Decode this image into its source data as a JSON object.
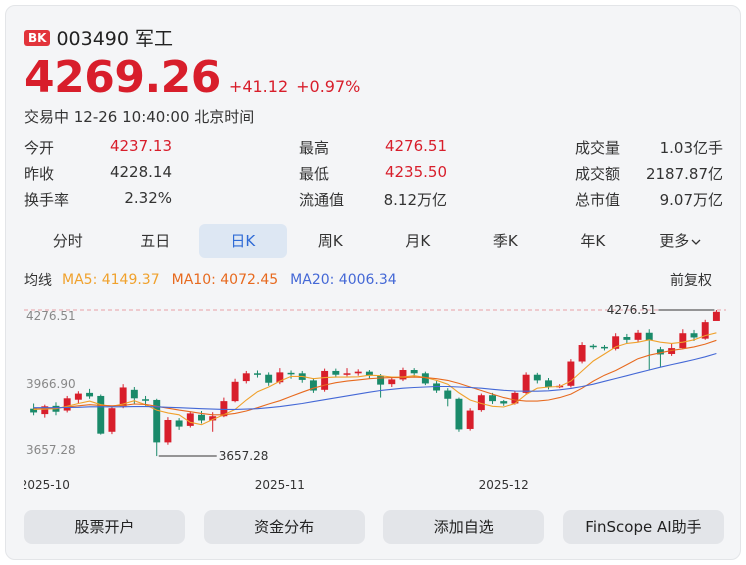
{
  "header": {
    "badge": "BK",
    "code_name": "003490 军工",
    "price": "4269.26",
    "change_abs": "+41.12",
    "change_pct": "+0.97%",
    "status": "交易中 12-26 10:40:00 北京时间"
  },
  "stats": {
    "open": {
      "label": "今开",
      "value": "4237.13"
    },
    "high": {
      "label": "最高",
      "value": "4276.51"
    },
    "volume": {
      "label": "成交量",
      "value": "1.03亿手"
    },
    "prev_close": {
      "label": "昨收",
      "value": "4228.14"
    },
    "low": {
      "label": "最低",
      "value": "4235.50"
    },
    "turnover": {
      "label": "成交额",
      "value": "2187.87亿"
    },
    "turnover_rate": {
      "label": "换手率",
      "value": "2.32%"
    },
    "float_cap": {
      "label": "流通值",
      "value": "8.12万亿"
    },
    "total_cap": {
      "label": "总市值",
      "value": "9.07万亿"
    }
  },
  "tabs": [
    {
      "label": "分时"
    },
    {
      "label": "五日"
    },
    {
      "label": "日K"
    },
    {
      "label": "周K"
    },
    {
      "label": "月K"
    },
    {
      "label": "季K"
    },
    {
      "label": "年K"
    },
    {
      "label": "更多"
    }
  ],
  "active_tab": 2,
  "ma": {
    "label": "均线",
    "ma5": "MA5: 4149.37",
    "ma10": "MA10: 4072.45",
    "ma20": "MA20: 4006.34",
    "adjust": "前复权"
  },
  "colors": {
    "up": "#d81e2b",
    "down": "#1a8a6a",
    "ma5": "#f0a12c",
    "ma10": "#e76a1f",
    "ma20": "#4468d6",
    "accent": "#2f6bd6"
  },
  "chart_data": {
    "type": "candlestick",
    "y_ticks": [
      "4276.51",
      "3966.90",
      "3657.28"
    ],
    "ylim": [
      3657.28,
      4276.51
    ],
    "x_ticks": [
      {
        "label": "2025-10",
        "index": 1
      },
      {
        "label": "2025-11",
        "index": 22
      },
      {
        "label": "2025-12",
        "index": 42
      }
    ],
    "max_label": "4276.51",
    "min_label": "3657.28",
    "candles": [
      [
        3858,
        3842,
        3880,
        3830
      ],
      [
        3835,
        3868,
        3875,
        3820
      ],
      [
        3870,
        3845,
        3885,
        3830
      ],
      [
        3850,
        3902,
        3912,
        3842
      ],
      [
        3896,
        3922,
        3932,
        3882
      ],
      [
        3925,
        3910,
        3942,
        3900
      ],
      [
        3912,
        3752,
        3918,
        3748
      ],
      [
        3760,
        3860,
        3870,
        3750
      ],
      [
        3868,
        3948,
        3962,
        3860
      ],
      [
        3938,
        3902,
        3950,
        3880
      ],
      [
        3898,
        3895,
        3912,
        3870
      ],
      [
        3895,
        3715,
        3900,
        3657
      ],
      [
        3715,
        3810,
        3822,
        3705
      ],
      [
        3808,
        3782,
        3818,
        3768
      ],
      [
        3785,
        3838,
        3847,
        3778
      ],
      [
        3832,
        3808,
        3848,
        3795
      ],
      [
        3808,
        3826,
        3843,
        3760
      ],
      [
        3826,
        3890,
        3905,
        3822
      ],
      [
        3890,
        3972,
        3985,
        3885
      ],
      [
        3975,
        4008,
        4018,
        3965
      ],
      [
        4008,
        4002,
        4020,
        3990
      ],
      [
        4002,
        3968,
        4012,
        3955
      ],
      [
        3970,
        4012,
        4030,
        3962
      ],
      [
        4010,
        4005,
        4020,
        3985
      ],
      [
        4008,
        3980,
        4018,
        3968
      ],
      [
        3978,
        3935,
        3988,
        3925
      ],
      [
        3938,
        4018,
        4028,
        3930
      ],
      [
        4018,
        4002,
        4028,
        3990
      ],
      [
        4002,
        4008,
        4030,
        3995
      ],
      [
        4008,
        4015,
        4025,
        3998
      ],
      [
        4015,
        3998,
        4022,
        3985
      ],
      [
        3998,
        3960,
        4005,
        3905
      ],
      [
        3962,
        3982,
        3990,
        3950
      ],
      [
        3982,
        4022,
        4032,
        3975
      ],
      [
        4022,
        4008,
        4030,
        3990
      ],
      [
        4008,
        3965,
        4015,
        3958
      ],
      [
        3965,
        3935,
        3975,
        3925
      ],
      [
        3935,
        3900,
        3945,
        3868
      ],
      [
        3900,
        3770,
        3905,
        3760
      ],
      [
        3772,
        3850,
        3860,
        3765
      ],
      [
        3852,
        3915,
        3922,
        3845
      ],
      [
        3915,
        3890,
        3925,
        3878
      ],
      [
        3890,
        3880,
        3895,
        3870
      ],
      [
        3880,
        3925,
        3932,
        3875
      ],
      [
        3925,
        4002,
        4012,
        3918
      ],
      [
        4002,
        3978,
        4010,
        3965
      ],
      [
        3978,
        3950,
        3988,
        3940
      ],
      [
        3950,
        3955,
        3962,
        3945
      ],
      [
        3955,
        4058,
        4068,
        3948
      ],
      [
        4058,
        4128,
        4140,
        4050
      ],
      [
        4125,
        4120,
        4132,
        4110
      ],
      [
        4120,
        4115,
        4128,
        4105
      ],
      [
        4112,
        4165,
        4178,
        4105
      ],
      [
        4162,
        4150,
        4175,
        4135
      ],
      [
        4150,
        4180,
        4192,
        4140
      ],
      [
        4180,
        4148,
        4195,
        4020
      ],
      [
        4110,
        4088,
        4120,
        4035
      ],
      [
        4090,
        4115,
        4135,
        4082
      ],
      [
        4115,
        4178,
        4195,
        4110
      ],
      [
        4178,
        4160,
        4192,
        4145
      ],
      [
        4155,
        4225,
        4235,
        4150
      ],
      [
        4230,
        4269,
        4276.51,
        4235.5
      ]
    ],
    "ma5": [
      3855,
      3856,
      3858,
      3868,
      3880,
      3890,
      3875,
      3868,
      3878,
      3892,
      3875,
      3852,
      3840,
      3832,
      3800,
      3790,
      3812,
      3832,
      3855,
      3895,
      3930,
      3950,
      3975,
      3995,
      3995,
      3985,
      3990,
      3992,
      3992,
      3993,
      4000,
      3998,
      3992,
      3992,
      3998,
      3990,
      3978,
      3962,
      3925,
      3895,
      3880,
      3868,
      3865,
      3880,
      3918,
      3945,
      3950,
      3952,
      3975,
      4018,
      4060,
      4090,
      4120,
      4135,
      4140,
      4150,
      4140,
      4135,
      4140,
      4150,
      4168,
      4180
    ],
    "ma10": [
      3860,
      3860,
      3861,
      3865,
      3870,
      3875,
      3872,
      3870,
      3872,
      3878,
      3876,
      3868,
      3860,
      3852,
      3845,
      3838,
      3832,
      3832,
      3838,
      3848,
      3862,
      3878,
      3892,
      3910,
      3928,
      3945,
      3958,
      3968,
      3975,
      3980,
      3985,
      3988,
      3990,
      3990,
      3992,
      3990,
      3985,
      3978,
      3965,
      3950,
      3935,
      3920,
      3905,
      3895,
      3890,
      3890,
      3895,
      3905,
      3920,
      3945,
      3975,
      4000,
      4020,
      4045,
      4070,
      4085,
      4095,
      4105,
      4112,
      4120,
      4132,
      4148
    ],
    "ma20": [
      3862,
      3862,
      3862,
      3863,
      3864,
      3866,
      3866,
      3866,
      3866,
      3867,
      3867,
      3866,
      3864,
      3862,
      3860,
      3858,
      3856,
      3855,
      3855,
      3856,
      3858,
      3862,
      3867,
      3873,
      3880,
      3888,
      3896,
      3904,
      3912,
      3920,
      3928,
      3935,
      3940,
      3945,
      3948,
      3950,
      3952,
      3952,
      3950,
      3948,
      3945,
      3940,
      3936,
      3933,
      3932,
      3932,
      3934,
      3938,
      3944,
      3952,
      3962,
      3974,
      3986,
      3998,
      4010,
      4022,
      4034,
      4045,
      4055,
      4066,
      4078,
      4092
    ]
  },
  "actions": [
    {
      "label": "股票开户"
    },
    {
      "label": "资金分布"
    },
    {
      "label": "添加自选"
    },
    {
      "label": "FinScope AI助手"
    }
  ]
}
